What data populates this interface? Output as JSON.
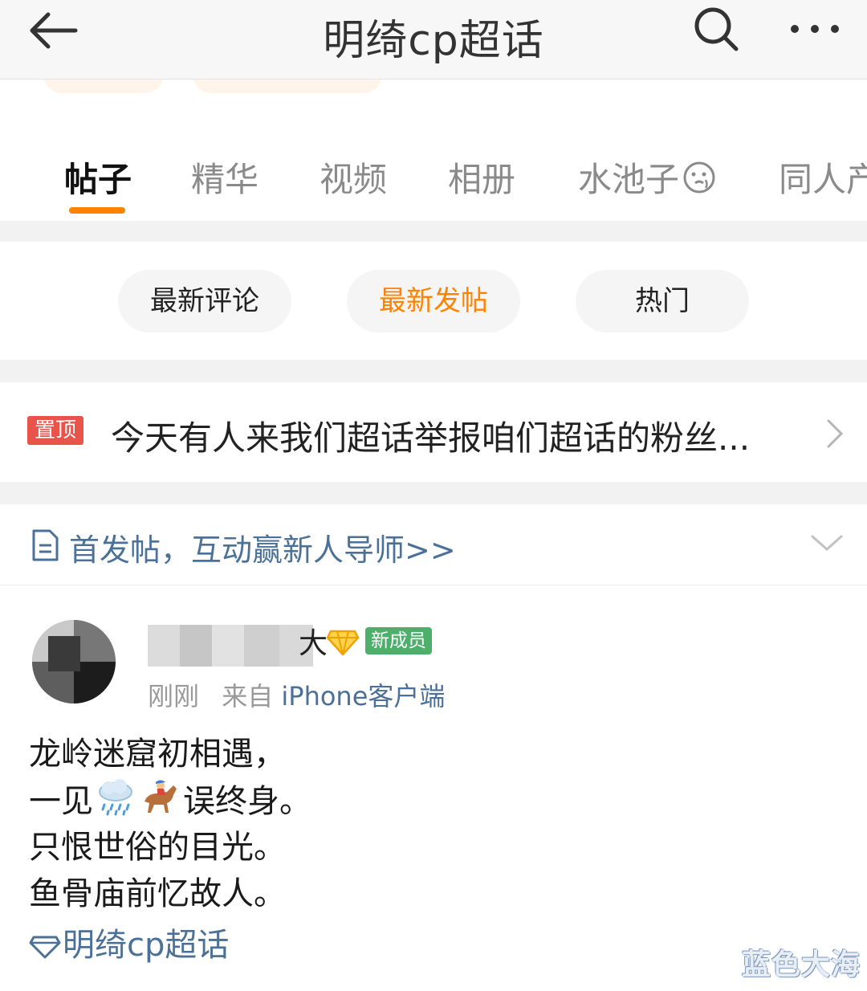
{
  "header": {
    "title": "明绮cp超话",
    "back_icon": "arrow-left-icon",
    "search_icon": "search-icon",
    "more_icon": "more-dots-icon"
  },
  "tabs": [
    {
      "label": "帖子",
      "active": true
    },
    {
      "label": "精华",
      "active": false
    },
    {
      "label": "视频",
      "active": false
    },
    {
      "label": "相册",
      "active": false
    },
    {
      "label": "水池子",
      "icon": "water-face-icon",
      "active": false
    },
    {
      "label": "同人产",
      "active": false
    }
  ],
  "sort": {
    "options": [
      {
        "label": "最新评论",
        "active": false
      },
      {
        "label": "最新发帖",
        "active": true
      },
      {
        "label": "热门",
        "active": false
      }
    ]
  },
  "pinned": {
    "badge": "置顶",
    "text": "今天有人来我们超话举报咱们超话的粉丝..."
  },
  "tip": {
    "icon": "document-icon",
    "text": "首发帖，互动赢新人导师>>"
  },
  "post": {
    "username_tail": "大",
    "badge_icon": "diamond-badge-icon",
    "member_badge": "新成员",
    "time": "刚刚",
    "source_prefix": "来自",
    "source": "iPhone客户端",
    "lines": {
      "l1": "龙岭迷窟初相遇，",
      "l2_a": "一见",
      "l2_b": "误终身。",
      "l3": "只恨世俗的目光。",
      "l4": "鱼骨庙前忆故人。"
    },
    "emojis": [
      "rain-cloud-icon",
      "horse-racing-icon"
    ],
    "topic": "明绮cp超话"
  },
  "watermark": "蓝色大海",
  "colors": {
    "accent": "#ff8200",
    "link": "#4b7199",
    "pin_badge": "#e8534a",
    "member_badge": "#4caf6a"
  }
}
